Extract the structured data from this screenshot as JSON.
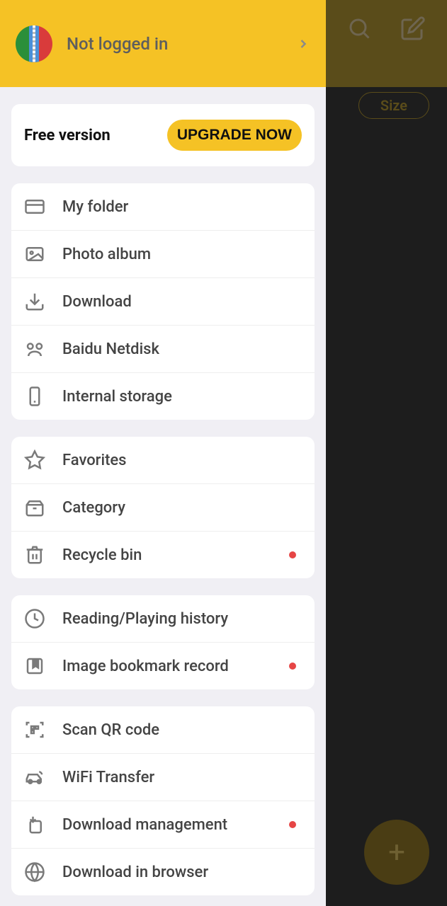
{
  "underlay": {
    "chip_size": "Size"
  },
  "header": {
    "login_status": "Not logged in"
  },
  "version": {
    "label": "Free version",
    "upgrade_button": "UPGRADE NOW"
  },
  "groups": [
    {
      "items": [
        {
          "key": "my-folder",
          "label": "My folder",
          "icon": "folder",
          "dot": false
        },
        {
          "key": "photo-album",
          "label": "Photo album",
          "icon": "image",
          "dot": false
        },
        {
          "key": "download",
          "label": "Download",
          "icon": "download",
          "dot": false
        },
        {
          "key": "baidu-netdisk",
          "label": "Baidu Netdisk",
          "icon": "netdisk",
          "dot": false
        },
        {
          "key": "internal-storage",
          "label": "Internal storage",
          "icon": "phone",
          "dot": false
        }
      ]
    },
    {
      "items": [
        {
          "key": "favorites",
          "label": "Favorites",
          "icon": "star",
          "dot": false
        },
        {
          "key": "category",
          "label": "Category",
          "icon": "box",
          "dot": false
        },
        {
          "key": "recycle-bin",
          "label": "Recycle bin",
          "icon": "trash",
          "dot": true
        }
      ]
    },
    {
      "items": [
        {
          "key": "reading-history",
          "label": "Reading/Playing history",
          "icon": "clock",
          "dot": false
        },
        {
          "key": "image-bookmark",
          "label": "Image bookmark record",
          "icon": "bookmark",
          "dot": true
        }
      ]
    },
    {
      "items": [
        {
          "key": "scan-qr",
          "label": "Scan QR code",
          "icon": "qr",
          "dot": false
        },
        {
          "key": "wifi-transfer",
          "label": "WiFi Transfer",
          "icon": "car",
          "dot": false
        },
        {
          "key": "download-management",
          "label": "Download management",
          "icon": "download-mgmt",
          "dot": true
        },
        {
          "key": "download-browser",
          "label": "Download in browser",
          "icon": "globe",
          "dot": false
        }
      ]
    }
  ]
}
